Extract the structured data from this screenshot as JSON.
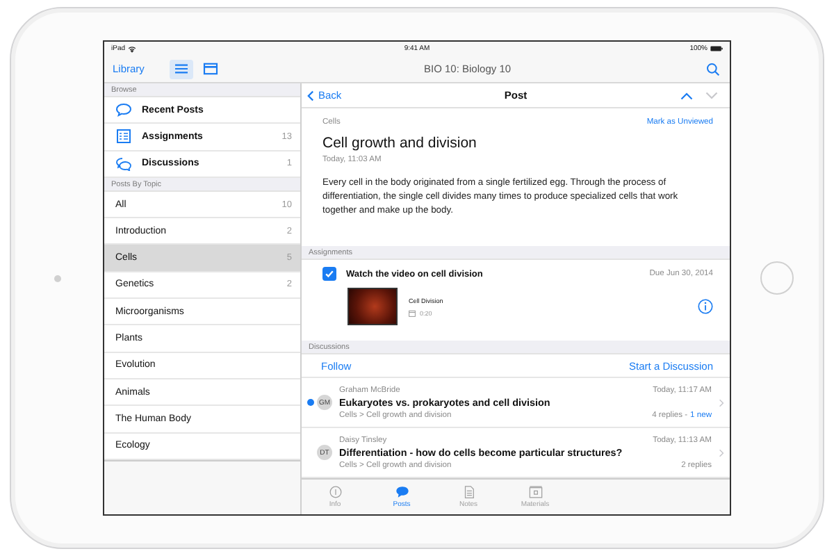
{
  "status_bar": {
    "device": "iPad",
    "time": "9:41 AM",
    "battery": "100%"
  },
  "nav_bar": {
    "back": "Library",
    "view_toggles": [
      {
        "kind": "list",
        "selected": true
      },
      {
        "kind": "grid",
        "selected": false
      }
    ],
    "title": "BIO 10: Biology 10"
  },
  "sidebar": {
    "browse_header": "Browse",
    "browse_items": [
      {
        "kind": "posts",
        "label": "Recent Posts"
      },
      {
        "kind": "assignments",
        "label": "Assignments",
        "count": "13"
      },
      {
        "kind": "discussions",
        "label": "Discussions",
        "count": "1"
      }
    ],
    "topics_header": "Posts By Topic",
    "topics": [
      {
        "label": "All",
        "count": "10",
        "selected": false
      },
      {
        "label": "Introduction",
        "count": "2",
        "selected": false
      },
      {
        "label": "Cells",
        "count": "5",
        "selected": true
      },
      {
        "label": "Genetics",
        "count": "2",
        "selected": false
      },
      {
        "label": "Microorganisms",
        "selected": false
      },
      {
        "label": "Plants",
        "selected": false
      },
      {
        "label": "Evolution",
        "selected": false
      },
      {
        "label": "Animals",
        "selected": false
      },
      {
        "label": "The Human Body",
        "selected": false
      },
      {
        "label": "Ecology",
        "selected": false
      }
    ]
  },
  "post": {
    "back": "Back",
    "title": "Post",
    "prev_enabled": true,
    "next_enabled": false,
    "topic": "Cells",
    "mark_action": "Mark as Unviewed",
    "heading": "Cell growth and division",
    "date": "Today, 11:03 AM",
    "body": "Every cell in the body originated from a single fertilized egg. Through the process of differentiation, the single cell divides many times to produce specialized cells that work together and make up the body."
  },
  "assignments": {
    "header": "Assignments",
    "items": [
      {
        "checked": true,
        "title": "Watch the video on cell division",
        "due": "Due Jun 30, 2014",
        "video_title": "Cell Division",
        "duration": "0:20"
      }
    ]
  },
  "discussions": {
    "header": "Discussions",
    "follow": "Follow",
    "start": "Start a Discussion",
    "items": [
      {
        "author": "Graham McBride",
        "initials": "GM",
        "unread": true,
        "title": "Eukaryotes vs. prokaryotes and cell division",
        "path": "Cells > Cell growth and division",
        "time": "Today, 11:17 AM",
        "replies": "4 replies -",
        "new": "1 new"
      },
      {
        "author": "Daisy Tinsley",
        "initials": "DT",
        "unread": false,
        "title": "Differentiation - how do cells become particular structures?",
        "path": "Cells > Cell growth and division",
        "time": "Today, 11:13 AM",
        "replies": "2 replies"
      }
    ]
  },
  "tab_bar": [
    {
      "kind": "info",
      "label": "Info",
      "selected": false
    },
    {
      "kind": "posts",
      "label": "Posts",
      "selected": true
    },
    {
      "kind": "notes",
      "label": "Notes",
      "selected": false
    },
    {
      "kind": "materials",
      "label": "Materials",
      "selected": false
    }
  ]
}
